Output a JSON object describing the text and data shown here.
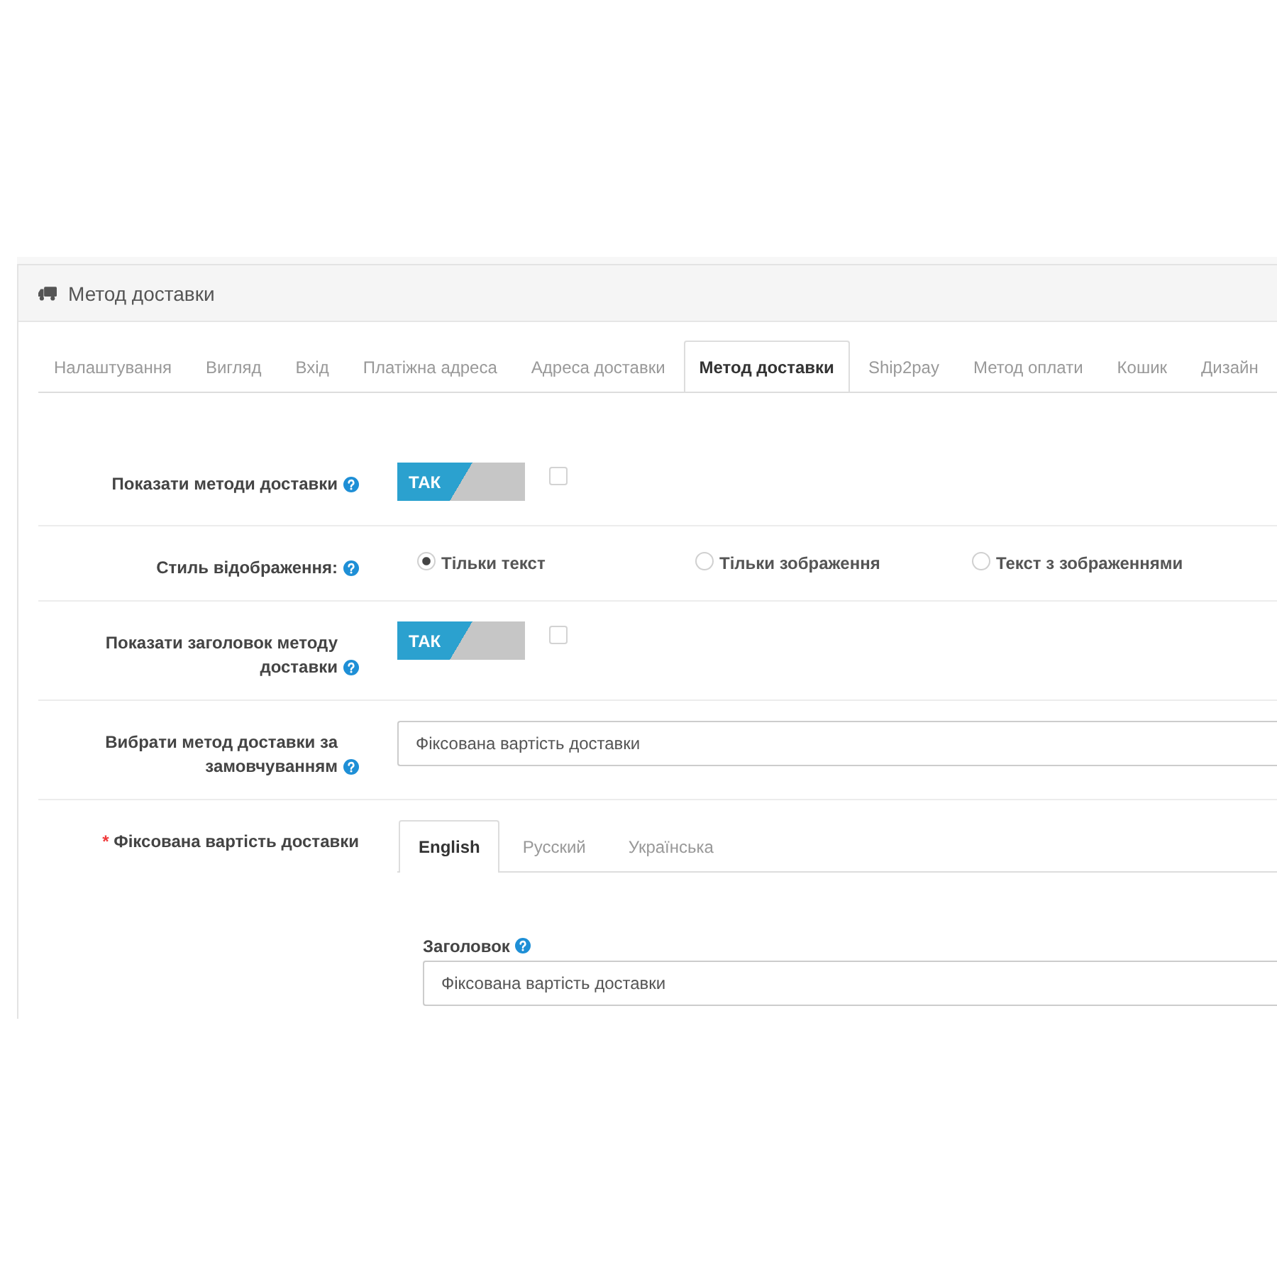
{
  "panel": {
    "title": "Метод доставки"
  },
  "tabs": [
    {
      "label": "Налаштування",
      "selected": false
    },
    {
      "label": "Вигляд",
      "selected": false
    },
    {
      "label": "Вхід",
      "selected": false
    },
    {
      "label": "Платіжна адреса",
      "selected": false
    },
    {
      "label": "Адреса доставки",
      "selected": false
    },
    {
      "label": "Метод доставки",
      "selected": true
    },
    {
      "label": "Ship2pay",
      "selected": false
    },
    {
      "label": "Метод оплати",
      "selected": false
    },
    {
      "label": "Кошик",
      "selected": false
    },
    {
      "label": "Дизайн",
      "selected": false
    }
  ],
  "fields": [
    {
      "kind": "toggle",
      "label": "Показати методи доставки",
      "help": true,
      "toggle": {
        "label": "ТАК",
        "on": true
      },
      "checkbox": {
        "checked": false
      }
    },
    {
      "kind": "radio",
      "label": "Стиль відображення:",
      "help": true,
      "options": [
        {
          "label": "Тільки текст",
          "selected": true
        },
        {
          "label": "Тільки зображення",
          "selected": false
        },
        {
          "label": "Текст з зображеннями",
          "selected": false
        }
      ]
    },
    {
      "kind": "toggle",
      "label": "Показати заголовок методу доставки",
      "help": true,
      "toggle": {
        "label": "ТАК",
        "on": true
      },
      "checkbox": {
        "checked": false
      }
    },
    {
      "kind": "select",
      "label": "Вибрати метод доставки за замовчуванням",
      "help": true,
      "value": "Фіксована вартість доставки"
    },
    {
      "kind": "multilang",
      "label": "Фіксована вартість доставки",
      "required_mark": "*",
      "language_tabs": [
        {
          "label": "English",
          "selected": true
        },
        {
          "label": "Русский",
          "selected": false
        },
        {
          "label": "Українська",
          "selected": false
        }
      ],
      "subfield": {
        "label": "Заголовок",
        "help": true,
        "value": "Фіксована вартість доставки"
      }
    }
  ]
}
